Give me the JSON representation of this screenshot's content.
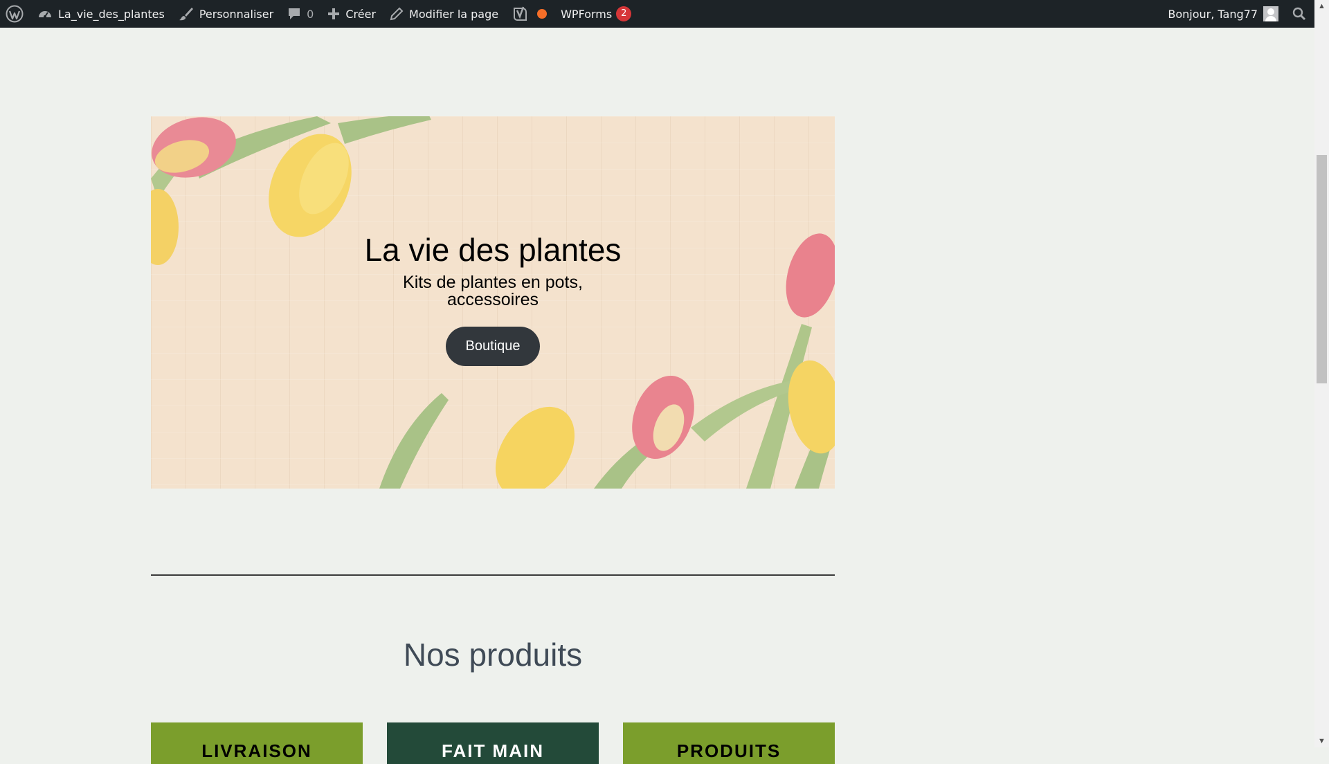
{
  "admin_bar": {
    "site_name": "La_vie_des_plantes",
    "customize_label": "Personnaliser",
    "comments_count": "0",
    "new_label": "Créer",
    "edit_label": "Modifier la page",
    "wpforms_label": "WPForms",
    "wpforms_badge": "2",
    "greeting": "Bonjour, Tang77",
    "colors": {
      "background": "#1d2327",
      "text": "#f0f0f1",
      "badge": "#d63638",
      "seo_dot": "#f56e28"
    }
  },
  "hero": {
    "title": "La vie des plantes",
    "subtitle": "Kits de plantes en pots, accessoires",
    "button_label": "Boutique"
  },
  "products_section": {
    "title": "Nos produits",
    "cards": [
      {
        "label": "LIVRAISON",
        "color": "#7b9e2c"
      },
      {
        "label": "FAIT MAIN",
        "color": "#234a39"
      },
      {
        "label": "PRODUITS",
        "color": "#7b9e2c"
      }
    ]
  },
  "page": {
    "background": "#eef1ed"
  }
}
